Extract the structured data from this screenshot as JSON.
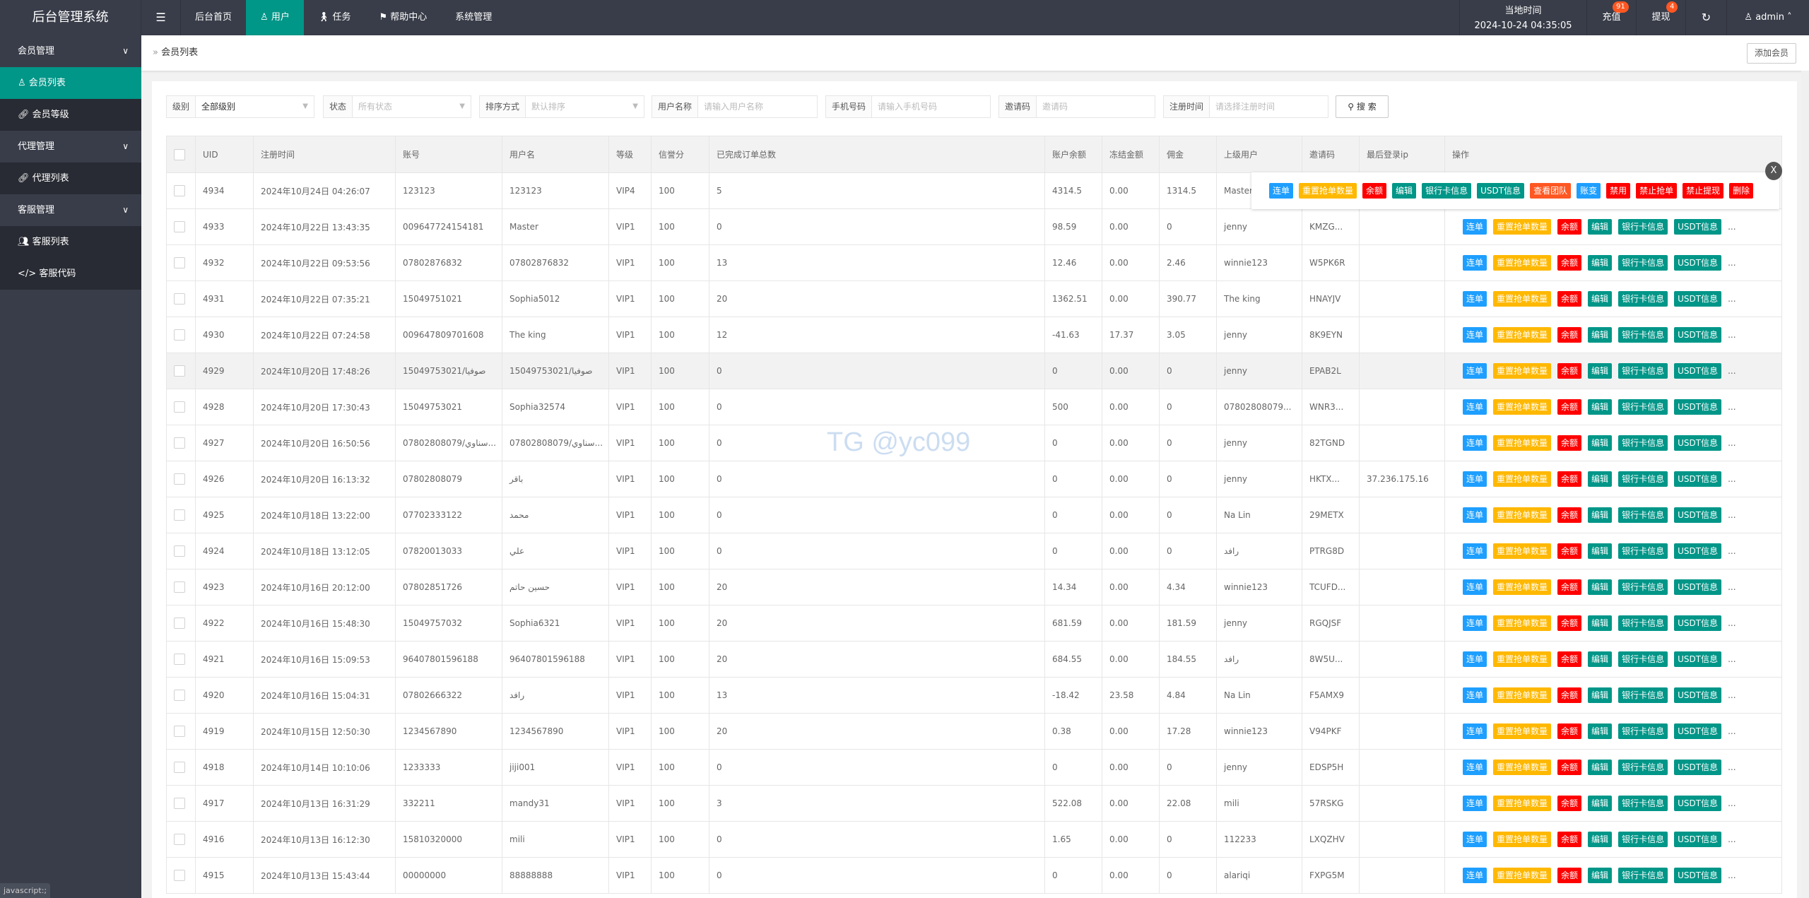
{
  "app_title": "后台管理系统",
  "nav": {
    "menu_icon": "hamburger-icon",
    "items": [
      {
        "label": "后台首页",
        "icon": ""
      },
      {
        "label": "用户",
        "icon": "user-icon",
        "active": true
      },
      {
        "label": "任务",
        "icon": "walk-icon"
      },
      {
        "label": "帮助中心",
        "icon": "flag-icon"
      },
      {
        "label": "系统管理",
        "icon": ""
      }
    ]
  },
  "header_right": {
    "time_label": "当地时间",
    "time_value": "2024-10-24 04:35:05",
    "recharge": "充值",
    "recharge_badge": "91",
    "withdraw": "提现",
    "withdraw_badge": "4",
    "user": "admin"
  },
  "sidebar": [
    {
      "label": "会员管理",
      "children": [
        {
          "label": "会员列表",
          "icon": "user-icon",
          "active": true
        },
        {
          "label": "会员等级",
          "icon": "link-icon"
        }
      ]
    },
    {
      "label": "代理管理",
      "children": [
        {
          "label": "代理列表",
          "icon": "link-icon"
        }
      ]
    },
    {
      "label": "客服管理",
      "children": [
        {
          "label": "客服列表",
          "icon": "users-icon"
        },
        {
          "label": "客服代码",
          "icon": "code-icon"
        }
      ]
    }
  ],
  "breadcrumb": "会员列表",
  "add_member": "添加会员",
  "filters": {
    "level": {
      "label": "级别",
      "value": "全部级别"
    },
    "status": {
      "label": "状态",
      "placeholder": "所有状态"
    },
    "sort": {
      "label": "排序方式",
      "placeholder": "默认排序"
    },
    "username": {
      "label": "用户名称",
      "placeholder": "请输入用户名称"
    },
    "phone": {
      "label": "手机号码",
      "placeholder": "请输入手机号码"
    },
    "invite": {
      "label": "邀请码",
      "placeholder": "邀请码"
    },
    "regtime": {
      "label": "注册时间",
      "placeholder": "请选择注册时间"
    },
    "search": "搜 索"
  },
  "table": {
    "headers": [
      "UID",
      "注册时间",
      "账号",
      "用户名",
      "等级",
      "信誉分",
      "已完成订单总数",
      "账户余额",
      "冻结金额",
      "佣金",
      "上级用户",
      "邀请码",
      "最后登录ip",
      "操作"
    ],
    "rows": [
      [
        "4934",
        "2024年10月24日 04:26:07",
        "123123",
        "123123",
        "VIP4",
        "100",
        "5",
        "4314.5",
        "0.00",
        "1314.5",
        "Master",
        "",
        ""
      ],
      [
        "4933",
        "2024年10月22日 13:43:35",
        "009647724154181",
        "Master",
        "VIP1",
        "100",
        "0",
        "98.59",
        "0.00",
        "0",
        "jenny",
        "KMZG...",
        ""
      ],
      [
        "4932",
        "2024年10月22日 09:53:56",
        "07802876832",
        "07802876832",
        "VIP1",
        "100",
        "13",
        "12.46",
        "0.00",
        "2.46",
        "winnie123",
        "W5PK6R",
        ""
      ],
      [
        "4931",
        "2024年10月22日 07:35:21",
        "15049751021",
        "Sophia5012",
        "VIP1",
        "100",
        "20",
        "1362.51",
        "0.00",
        "390.77",
        "The king",
        "HNAYJV",
        ""
      ],
      [
        "4930",
        "2024年10月22日 07:24:58",
        "009647809701608",
        "The king",
        "VIP1",
        "100",
        "12",
        "-41.63",
        "17.37",
        "3.05",
        "jenny",
        "8K9EYN",
        ""
      ],
      [
        "4929",
        "2024年10月20日 17:48:26",
        "15049753021/صوفيا",
        "15049753021/صوفيا",
        "VIP1",
        "100",
        "0",
        "0",
        "0.00",
        "0",
        "jenny",
        "EPAB2L",
        ""
      ],
      [
        "4928",
        "2024年10月20日 17:30:43",
        "15049753021",
        "Sophia32574",
        "VIP1",
        "100",
        "0",
        "500",
        "0.00",
        "0",
        "07802808079...",
        "WNR3...",
        ""
      ],
      [
        "4927",
        "2024年10月20日 16:50:56",
        "07802808079/سناوي...",
        "07802808079/سناوي...",
        "VIP1",
        "100",
        "0",
        "0",
        "0.00",
        "0",
        "jenny",
        "82TGND",
        ""
      ],
      [
        "4926",
        "2024年10月20日 16:13:32",
        "07802808079",
        "باقر",
        "VIP1",
        "100",
        "0",
        "0",
        "0.00",
        "0",
        "jenny",
        "HKTX...",
        "37.236.175.16"
      ],
      [
        "4925",
        "2024年10月18日 13:22:00",
        "07702333122",
        "محمد",
        "VIP1",
        "100",
        "0",
        "0",
        "0.00",
        "0",
        "Na Lin",
        "29METX",
        ""
      ],
      [
        "4924",
        "2024年10月18日 13:12:05",
        "07820013033",
        "علي",
        "VIP1",
        "100",
        "0",
        "0",
        "0.00",
        "0",
        "رافد",
        "PTRG8D",
        ""
      ],
      [
        "4923",
        "2024年10月16日 20:12:00",
        "07802851726",
        "حسين حاتم",
        "VIP1",
        "100",
        "20",
        "14.34",
        "0.00",
        "4.34",
        "winnie123",
        "TCUFD...",
        ""
      ],
      [
        "4922",
        "2024年10月16日 15:48:30",
        "15049757032",
        "Sophia6321",
        "VIP1",
        "100",
        "20",
        "681.59",
        "0.00",
        "181.59",
        "jenny",
        "RGQJSF",
        ""
      ],
      [
        "4921",
        "2024年10月16日 15:09:53",
        "96407801596188",
        "96407801596188",
        "VIP1",
        "100",
        "20",
        "684.55",
        "0.00",
        "184.55",
        "رافد",
        "8W5U...",
        ""
      ],
      [
        "4920",
        "2024年10月16日 15:04:31",
        "07802666322",
        "رافد",
        "VIP1",
        "100",
        "13",
        "-18.42",
        "23.58",
        "4.84",
        "Na Lin",
        "F5AMX9",
        ""
      ],
      [
        "4919",
        "2024年10月15日 12:50:30",
        "1234567890",
        "1234567890",
        "VIP1",
        "100",
        "20",
        "0.38",
        "0.00",
        "17.28",
        "winnie123",
        "V94PKF",
        ""
      ],
      [
        "4918",
        "2024年10月14日 10:10:06",
        "1233333",
        "jiji001",
        "VIP1",
        "100",
        "0",
        "0",
        "0.00",
        "0",
        "jenny",
        "EDSP5H",
        ""
      ],
      [
        "4917",
        "2024年10月13日 16:31:29",
        "332211",
        "mandy31",
        "VIP1",
        "100",
        "3",
        "522.08",
        "0.00",
        "22.08",
        "mili",
        "57RSKG",
        ""
      ],
      [
        "4916",
        "2024年10月13日 16:12:30",
        "15810320000",
        "mili",
        "VIP1",
        "100",
        "0",
        "1.65",
        "0.00",
        "0",
        "112233",
        "LXQZHV",
        ""
      ],
      [
        "4915",
        "2024年10月13日 15:43:44",
        "00000000",
        "88888888",
        "VIP1",
        "100",
        "0",
        "0",
        "0.00",
        "0",
        "alariqi",
        "FXPG5M",
        ""
      ]
    ],
    "row_actions": [
      {
        "label": "连单",
        "color": "blue"
      },
      {
        "label": "重置抢单数量",
        "color": "yel"
      },
      {
        "label": "余额",
        "color": "red"
      },
      {
        "label": "编辑",
        "color": "teal"
      },
      {
        "label": "银行卡信息",
        "color": "teal"
      },
      {
        "label": "USDT信息",
        "color": "teal"
      }
    ],
    "more": "...",
    "highlight_uid": "4929"
  },
  "popup_actions": [
    {
      "label": "连单",
      "color": "blue"
    },
    {
      "label": "重置抢单数量",
      "color": "yel"
    },
    {
      "label": "余额",
      "color": "red"
    },
    {
      "label": "编辑",
      "color": "teal"
    },
    {
      "label": "银行卡信息",
      "color": "teal"
    },
    {
      "label": "USDT信息",
      "color": "teal"
    },
    {
      "label": "查看团队",
      "color": "orange"
    },
    {
      "label": "账变",
      "color": "blue"
    },
    {
      "label": "禁用",
      "color": "red"
    },
    {
      "label": "禁止抢单",
      "color": "red"
    },
    {
      "label": "禁止提现",
      "color": "red"
    },
    {
      "label": "删除",
      "color": "red"
    }
  ],
  "popup_close": "X",
  "watermark": "TG @yc099",
  "status_bar": "javascript:;",
  "colors": {
    "topbar": "#393D49",
    "accent": "#009688",
    "blue": "#1E9FFF",
    "yellow": "#FFB800",
    "red": "#FF0000",
    "orange": "#FF5722"
  }
}
